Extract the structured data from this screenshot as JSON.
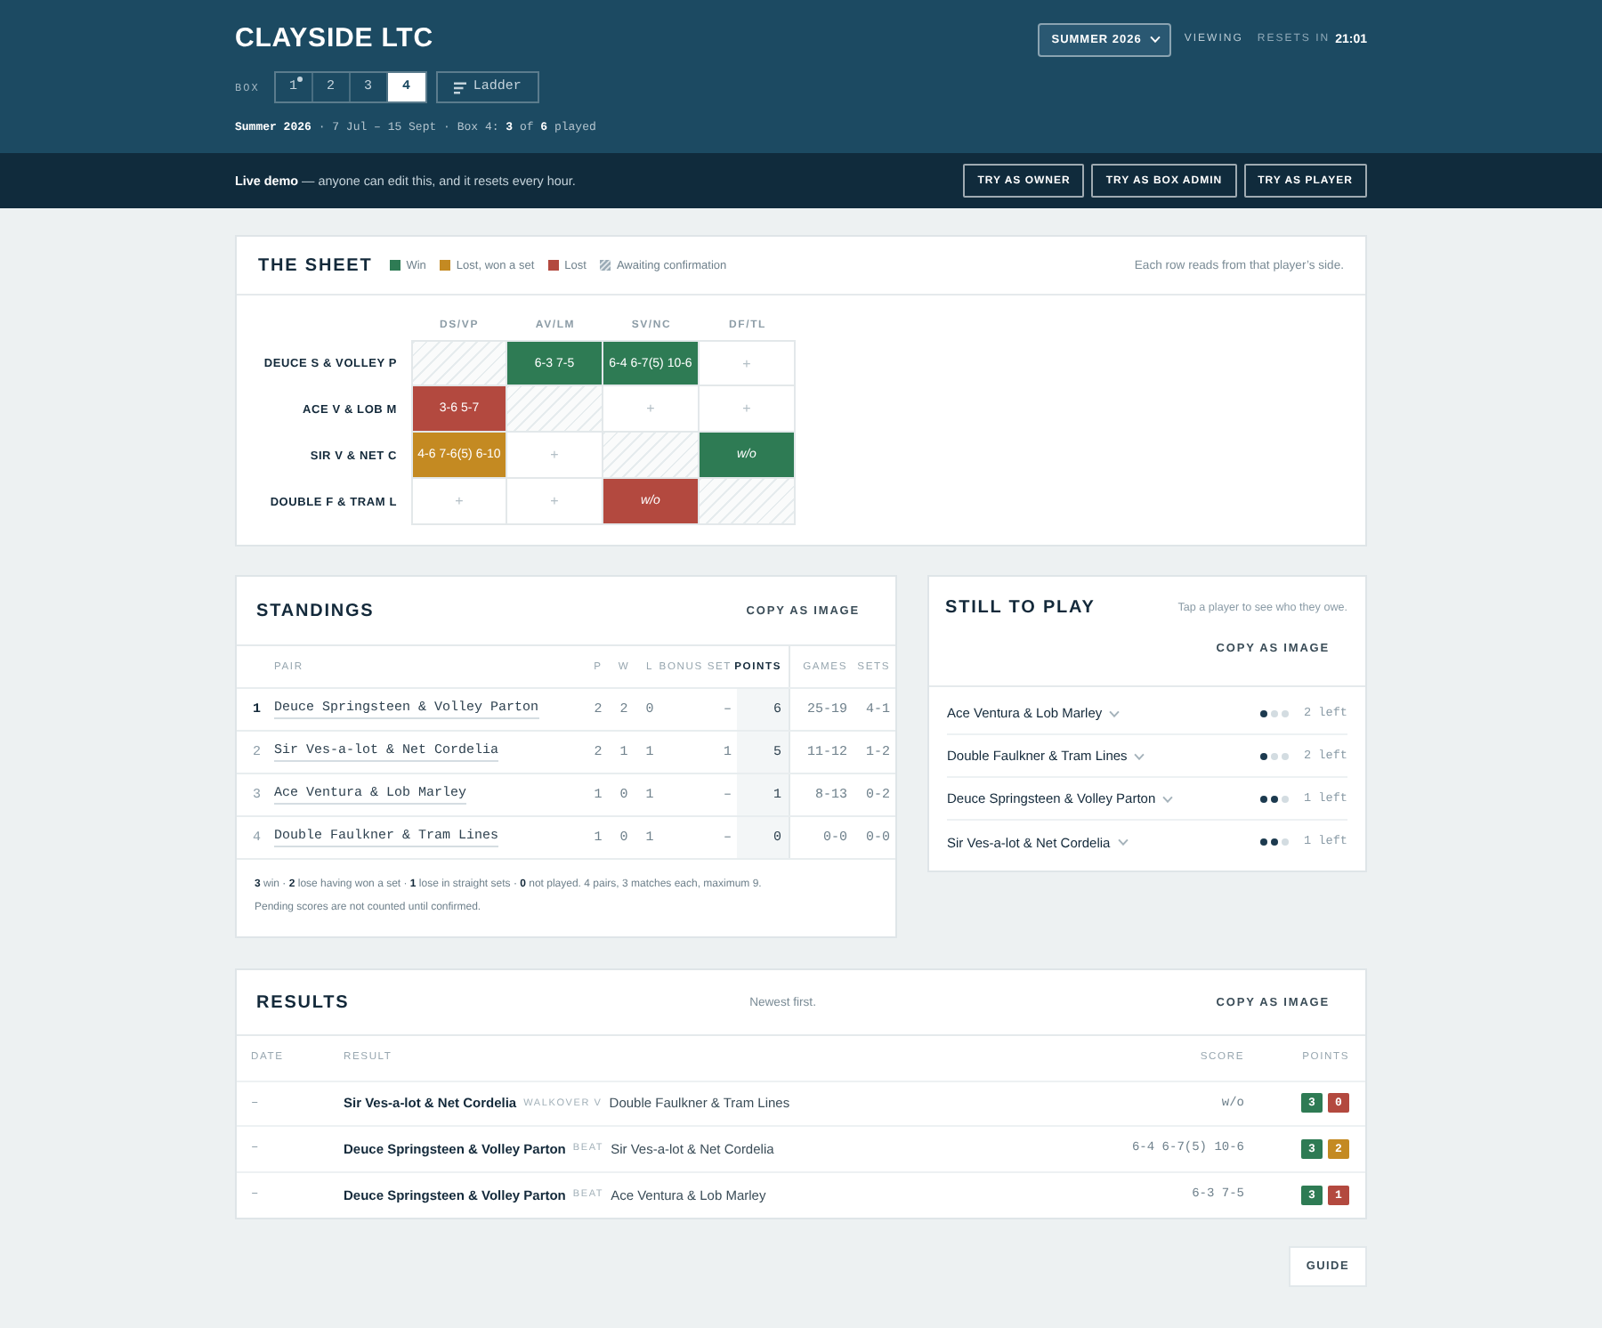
{
  "header": {
    "title": "CLAYSIDE LTC",
    "season_select": "SUMMER 2026",
    "viewing_label": "VIEWING",
    "resets_label": "RESETS IN",
    "resets_time": "21:01",
    "box_label": "BOX",
    "box_tabs": [
      {
        "label": "1",
        "selected": false,
        "marked": true
      },
      {
        "label": "2",
        "selected": false,
        "marked": false
      },
      {
        "label": "3",
        "selected": false,
        "marked": false
      },
      {
        "label": "4",
        "selected": true,
        "marked": false
      }
    ],
    "ladder_button": "Ladder",
    "summary": "**Summer 2026** · 7 Jul – 15 Sept · Box 4: **3** of **6** played"
  },
  "demo_bar": {
    "notice": "**Live demo** — anyone can edit this, and it resets every hour.",
    "buttons": [
      "TRY AS OWNER",
      "TRY AS BOX ADMIN",
      "TRY AS PLAYER"
    ]
  },
  "sheet": {
    "title": "THE SHEET",
    "legend": [
      {
        "kind": "solid",
        "color": "#2e7b54",
        "label": "Win"
      },
      {
        "kind": "solid",
        "color": "#c48a22",
        "label": "Lost, won a set"
      },
      {
        "kind": "solid",
        "color": "#b3493f",
        "label": "Lost"
      },
      {
        "kind": "hatch",
        "label": "Awaiting confirmation"
      }
    ],
    "note": "Each row reads from that player’s side.",
    "columns": [
      "DS/VP",
      "AV/LM",
      "SV/NC",
      "DF/TL"
    ],
    "rows": [
      {
        "label": "DEUCE S & VOLLEY P",
        "cells": [
          {
            "kind": "self"
          },
          {
            "kind": "win",
            "text": "6-3 7-5",
            "walkover": false
          },
          {
            "kind": "win",
            "text": "6-4 6-7(5) 10-6",
            "walkover": false
          },
          {
            "kind": "open",
            "text": "+"
          }
        ]
      },
      {
        "label": "ACE V & LOB M",
        "cells": [
          {
            "kind": "lost",
            "text": "3-6 5-7",
            "walkover": false
          },
          {
            "kind": "self"
          },
          {
            "kind": "open",
            "text": "+"
          },
          {
            "kind": "open",
            "text": "+"
          }
        ]
      },
      {
        "label": "SIR V & NET C",
        "cells": [
          {
            "kind": "lost_set",
            "text": "4-6 7-6(5) 6-10",
            "walkover": false
          },
          {
            "kind": "open",
            "text": "+"
          },
          {
            "kind": "self"
          },
          {
            "kind": "win",
            "text": "w/o",
            "walkover": true
          }
        ]
      },
      {
        "label": "DOUBLE F & TRAM L",
        "cells": [
          {
            "kind": "open",
            "text": "+"
          },
          {
            "kind": "open",
            "text": "+"
          },
          {
            "kind": "lost",
            "text": "w/o",
            "walkover": true
          },
          {
            "kind": "self"
          }
        ]
      }
    ]
  },
  "standings": {
    "title": "STANDINGS",
    "copy_button": "COPY AS IMAGE",
    "columns": [
      {
        "label": "PAIR",
        "highlighted": false
      },
      {
        "label": "P",
        "highlighted": false
      },
      {
        "label": "W",
        "highlighted": false
      },
      {
        "label": "L",
        "highlighted": false
      },
      {
        "label": "BONUS SET",
        "highlighted": false
      },
      {
        "label": "POINTS",
        "highlighted": true
      },
      {
        "label": "GAMES",
        "highlighted": false
      },
      {
        "label": "SETS",
        "highlighted": false
      }
    ],
    "rows": [
      {
        "rank": "1",
        "leader": true,
        "pair": "Deuce Springsteen & Volley Parton",
        "played": "2",
        "won": "2",
        "lost": "0",
        "bonus_set": "–",
        "points": "6",
        "games": "25-19",
        "sets": "4-1"
      },
      {
        "rank": "2",
        "leader": false,
        "pair": "Sir Ves-a-lot & Net Cordelia",
        "played": "2",
        "won": "1",
        "lost": "1",
        "bonus_set": "1",
        "points": "5",
        "games": "11-12",
        "sets": "1-2"
      },
      {
        "rank": "3",
        "leader": false,
        "pair": "Ace Ventura & Lob Marley",
        "played": "1",
        "won": "0",
        "lost": "1",
        "bonus_set": "–",
        "points": "1",
        "games": "8-13",
        "sets": "0-2"
      },
      {
        "rank": "4",
        "leader": false,
        "pair": "Double Faulkner & Tram Lines",
        "played": "1",
        "won": "0",
        "lost": "1",
        "bonus_set": "–",
        "points": "0",
        "games": "0-0",
        "sets": "0-0"
      }
    ],
    "footnotes": [
      "**3** win · **2** lose having won a set · **1** lose in straight sets · **0** not played. 4 pairs, 3 matches each, maximum 9.",
      "Pending scores are not counted until confirmed."
    ]
  },
  "still_to_play": {
    "title": "STILL TO PLAY",
    "hint": "Tap a player to see who they owe.",
    "copy_button": "COPY AS IMAGE",
    "rows": [
      {
        "pair": "Ace Ventura & Lob Marley",
        "dots": [
          {
            "filled": true
          },
          {
            "filled": false
          },
          {
            "filled": false
          }
        ],
        "remaining": "2 left"
      },
      {
        "pair": "Double Faulkner & Tram Lines",
        "dots": [
          {
            "filled": true
          },
          {
            "filled": false
          },
          {
            "filled": false
          }
        ],
        "remaining": "2 left"
      },
      {
        "pair": "Deuce Springsteen & Volley Parton",
        "dots": [
          {
            "filled": true
          },
          {
            "filled": true
          },
          {
            "filled": false
          }
        ],
        "remaining": "1 left"
      },
      {
        "pair": "Sir Ves-a-lot & Net Cordelia",
        "dots": [
          {
            "filled": true
          },
          {
            "filled": true
          },
          {
            "filled": false
          }
        ],
        "remaining": "1 left"
      }
    ]
  },
  "results": {
    "title": "RESULTS",
    "note": "Newest first.",
    "copy_button": "COPY AS IMAGE",
    "columns": [
      "DATE",
      "RESULT",
      "SCORE",
      "POINTS"
    ],
    "rows": [
      {
        "date": "–",
        "winner": "Sir Ves-a-lot & Net Cordelia",
        "verb": "WALKOVER V",
        "loser": "Double Faulkner & Tram Lines",
        "score": "w/o",
        "points": [
          {
            "value": "3",
            "kind": "win"
          },
          {
            "value": "0",
            "kind": "lost"
          }
        ]
      },
      {
        "date": "–",
        "winner": "Deuce Springsteen & Volley Parton",
        "verb": "BEAT",
        "loser": "Sir Ves-a-lot & Net Cordelia",
        "score": "6-4 6-7(5) 10-6",
        "points": [
          {
            "value": "3",
            "kind": "win"
          },
          {
            "value": "2",
            "kind": "lost_set"
          }
        ]
      },
      {
        "date": "–",
        "winner": "Deuce Springsteen & Volley Parton",
        "verb": "BEAT",
        "loser": "Ace Ventura & Lob Marley",
        "score": "6-3 7-5",
        "points": [
          {
            "value": "3",
            "kind": "win"
          },
          {
            "value": "1",
            "kind": "lost"
          }
        ]
      }
    ]
  },
  "guide_button": "GUIDE"
}
